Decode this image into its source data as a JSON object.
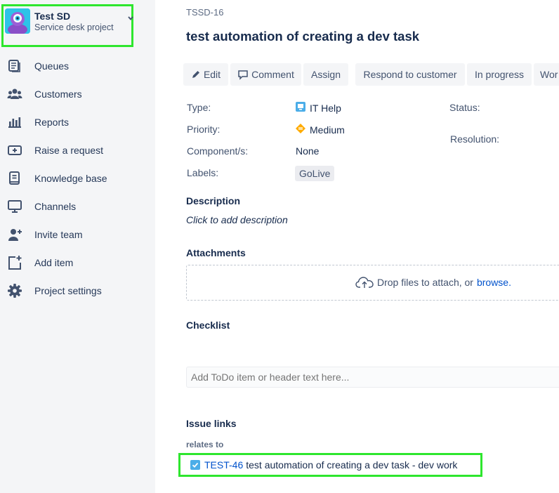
{
  "project": {
    "name": "Test SD",
    "type": "Service desk project"
  },
  "nav": [
    {
      "label": "Queues",
      "icon": "queues-icon"
    },
    {
      "label": "Customers",
      "icon": "customers-icon"
    },
    {
      "label": "Reports",
      "icon": "reports-icon"
    },
    {
      "label": "Raise a request",
      "icon": "raise-request-icon"
    },
    {
      "label": "Knowledge base",
      "icon": "knowledge-base-icon"
    },
    {
      "label": "Channels",
      "icon": "channels-icon"
    },
    {
      "label": "Invite team",
      "icon": "invite-team-icon"
    },
    {
      "label": "Add item",
      "icon": "add-item-icon"
    },
    {
      "label": "Project settings",
      "icon": "gear-icon"
    }
  ],
  "issue": {
    "key": "TSSD-16",
    "title": "test automation of creating a dev task"
  },
  "toolbar": {
    "edit": "Edit",
    "comment": "Comment",
    "assign": "Assign",
    "respond": "Respond to customer",
    "in_progress": "In progress",
    "workflow": "Wor"
  },
  "details": {
    "type_label": "Type:",
    "type_value": "IT Help",
    "priority_label": "Priority:",
    "priority_value": "Medium",
    "components_label": "Component/s:",
    "components_value": "None",
    "labels_label": "Labels:",
    "labels_value": "GoLive",
    "status_label": "Status:",
    "resolution_label": "Resolution:"
  },
  "description": {
    "heading": "Description",
    "placeholder": "Click to add description"
  },
  "attachments": {
    "heading": "Attachments",
    "drop_text": "Drop files to attach, or",
    "browse_link": "browse."
  },
  "checklist": {
    "heading": "Checklist",
    "placeholder": "Add ToDo item or header text here..."
  },
  "issue_links": {
    "heading": "Issue links",
    "relation": "relates to",
    "link_key": "TEST-46",
    "link_summary": "test automation of creating a dev task - dev work"
  },
  "colors": {
    "sidebar_bg": "#f4f5f7",
    "highlight": "#2ee62e",
    "link": "#0052cc",
    "avatar": "#2dc3e8"
  }
}
